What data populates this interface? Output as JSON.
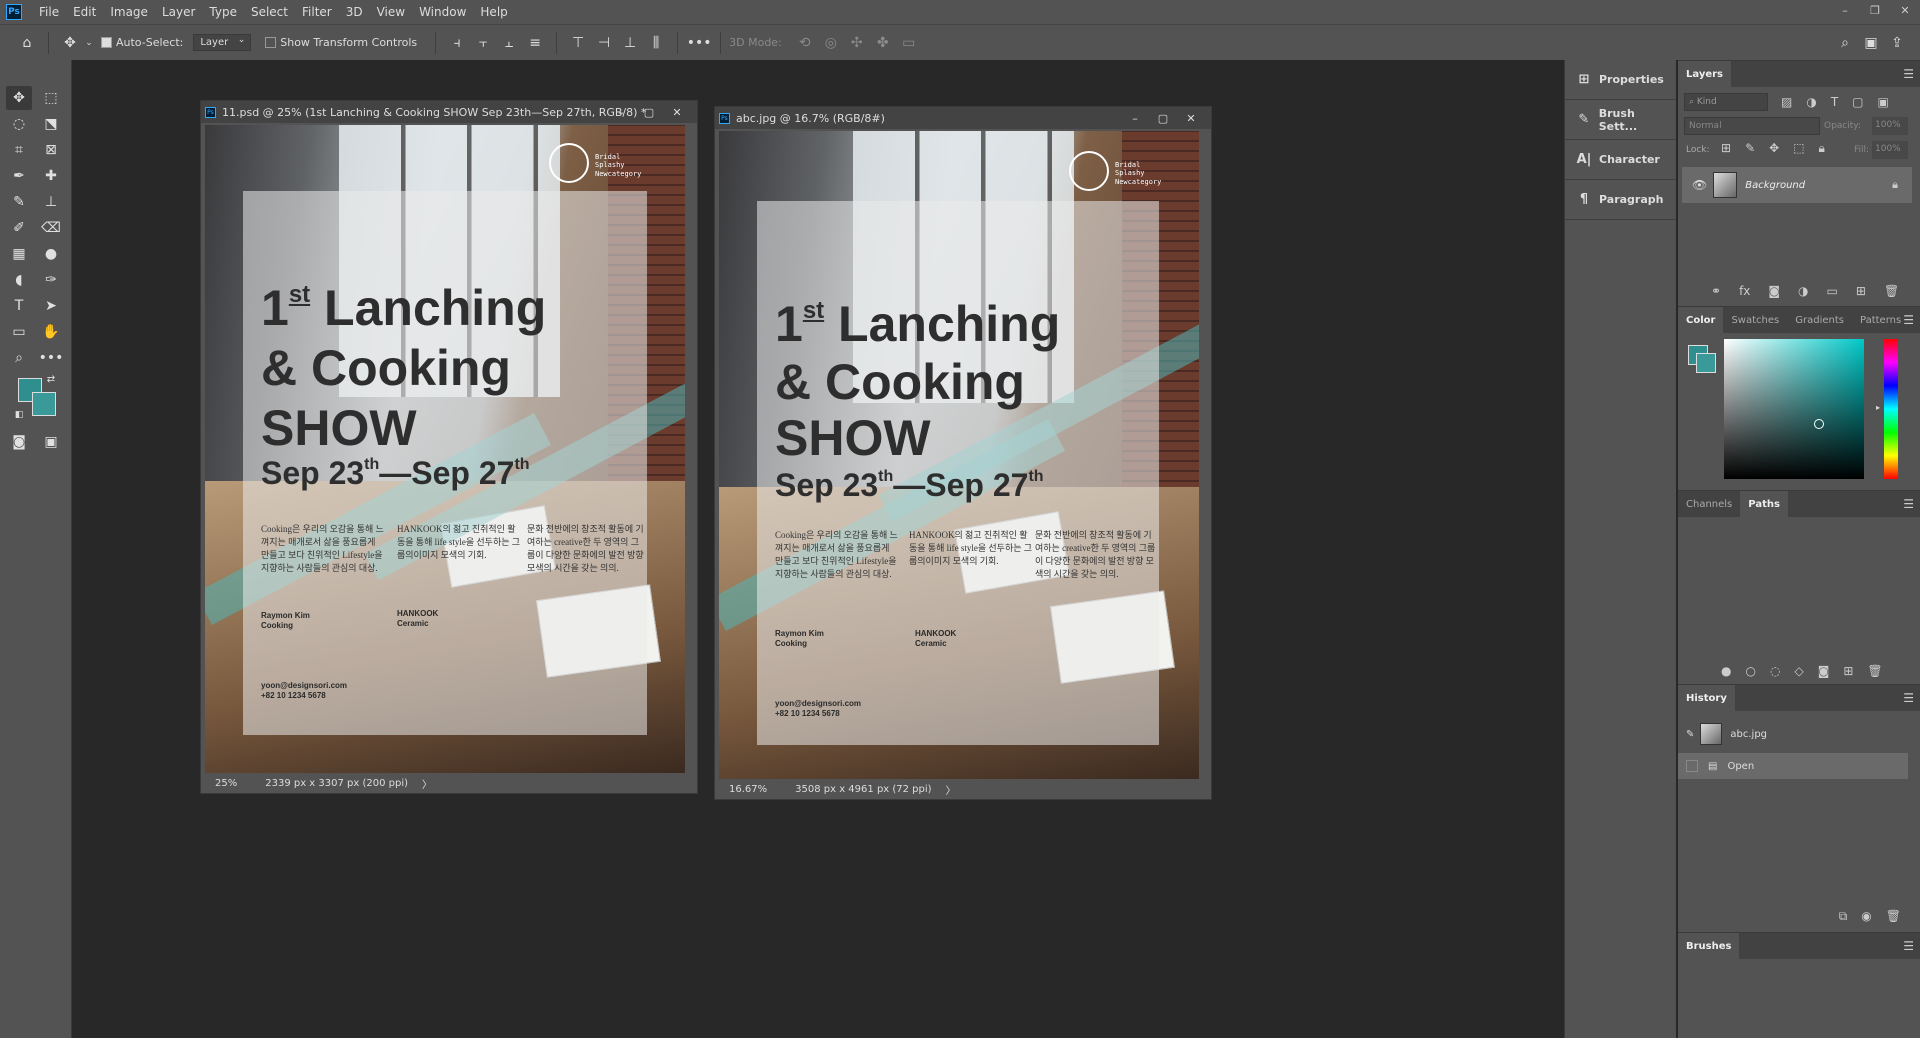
{
  "menubar": {
    "logo": "Ps",
    "items": [
      "File",
      "Edit",
      "Image",
      "Layer",
      "Type",
      "Select",
      "Filter",
      "3D",
      "View",
      "Window",
      "Help"
    ],
    "window_controls": [
      "–",
      "❐",
      "✕"
    ]
  },
  "options_bar": {
    "auto_select_label": "Auto-Select:",
    "auto_select_value": "Layer",
    "show_transform_label": "Show Transform Controls",
    "mode_3d_label": "3D Mode:",
    "more_label": "•••"
  },
  "colors": {
    "foreground": "#2f8f8f",
    "background": "#3a9a9a",
    "accent": "#31a8ff"
  },
  "doc1": {
    "title": "11.psd @ 25% (1st Lanching & Cooking SHOW Sep 23th—Sep 27th, RGB/8) *",
    "zoom": "25%",
    "size_info": "2339 px x 3307 px (200 ppi)",
    "status_arrow": "〉"
  },
  "doc2": {
    "title": "abc.jpg @ 16.7% (RGB/8#)",
    "zoom": "16.67%",
    "size_info": "3508 px x 4961 px (72 ppi)",
    "status_arrow": "〉"
  },
  "poster": {
    "logo_lines": [
      "Bridal",
      "Splashy",
      "Newcategory"
    ],
    "title_line1_num": "1",
    "title_line1_sup": "st",
    "title_line1_rest": " Lanching",
    "title_line2": "& Cooking",
    "title_line3": "SHOW",
    "date_a": "Sep 23",
    "date_a_sup": "th",
    "date_sep": "—",
    "date_b": "Sep 27",
    "date_b_sup": "th",
    "col1": "Cooking은 우리의 오감을 통해 느껴지는 매개로서 삶을 풍요롭게 만들고 보다 친위적인 Lifestyle을 지향하는 사람들의 관심의 대상.",
    "col2": "HANKOOK의 젊고 진취적인 활동을 통해 life style을 선두하는 그룹의이미지 모색의 기회.",
    "col3": "문화 전반에의 창조적 활동에 기여하는 creative한 두 영역의 그룹이 다양한 문화에의 발전 방향 모색의 시간을 갖는 의의.",
    "name1_a": "Raymon Kim",
    "name1_b": "Cooking",
    "name2_a": "HANKOOK",
    "name2_b": "Ceramic",
    "contact_email": "yoon@designsori.com",
    "contact_phone": "+82 10 1234 5678"
  },
  "panel_buttons": [
    {
      "icon": "⊞",
      "label": "Properties"
    },
    {
      "icon": "✎",
      "label": "Brush Sett..."
    },
    {
      "icon": "A|",
      "label": "Character"
    },
    {
      "icon": "¶",
      "label": "Paragraph"
    }
  ],
  "layers_panel": {
    "tab": "Layers",
    "kind_label": "Kind",
    "blend_mode": "Normal",
    "opacity_label": "Opacity:",
    "opacity_value": "100%",
    "lock_label": "Lock:",
    "fill_label": "Fill:",
    "fill_value": "100%",
    "layer_name": "Background"
  },
  "color_panel": {
    "tabs": [
      "Color",
      "Swatches",
      "Gradients",
      "Patterns"
    ]
  },
  "paths_panel": {
    "tabs": [
      "Channels",
      "Paths"
    ]
  },
  "history_panel": {
    "tab": "History",
    "rows": [
      "abc.jpg",
      "Open"
    ]
  },
  "brushes_panel": {
    "tab": "Brushes"
  }
}
